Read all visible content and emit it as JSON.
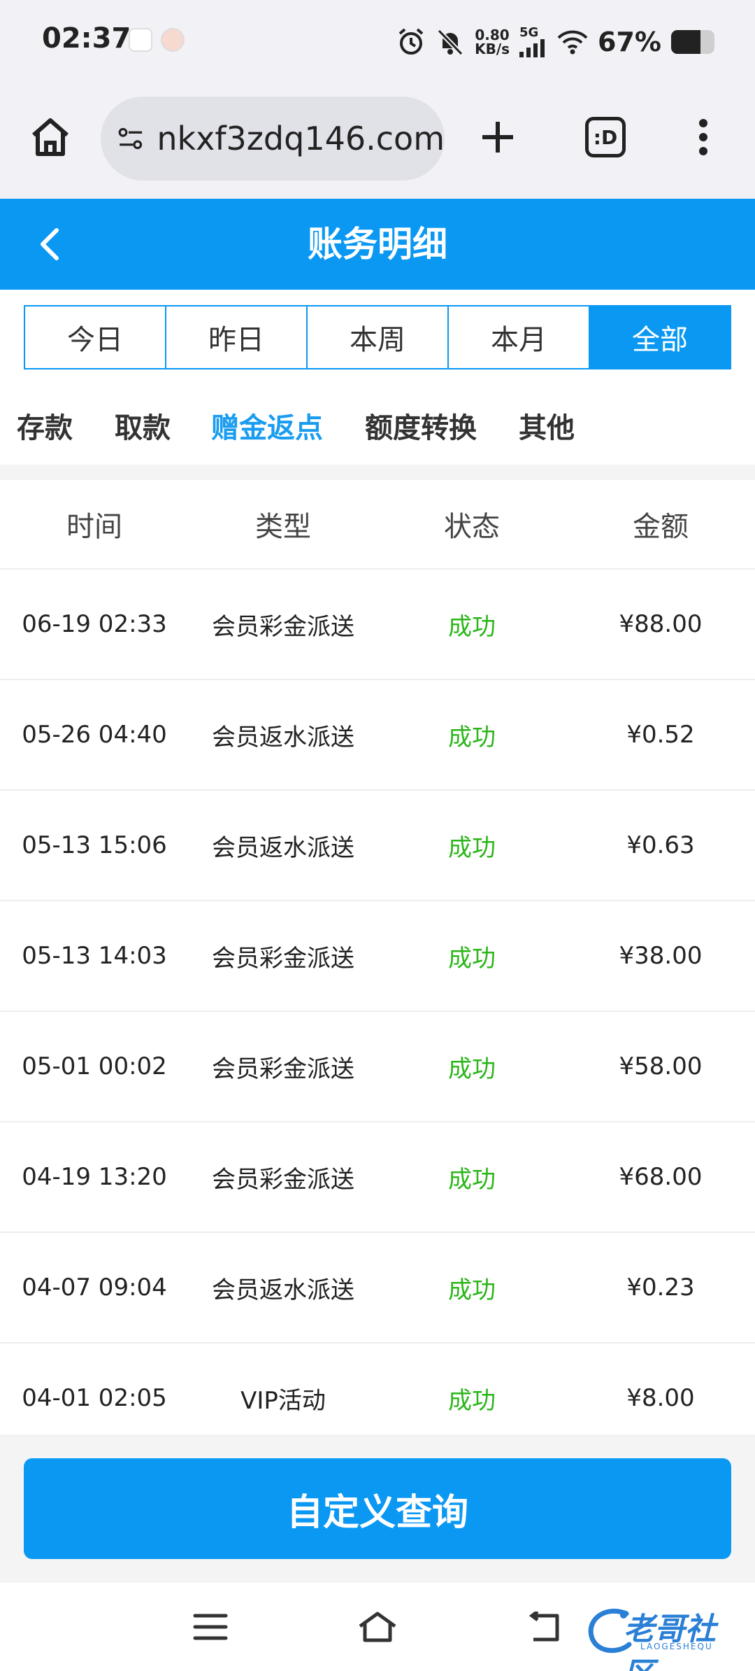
{
  "status_bar": {
    "time": "02:37",
    "network_speed_value": "0.80",
    "network_speed_unit": "KB/s",
    "network_type": "5G",
    "battery_text": "67%",
    "battery_level": 0.67
  },
  "browser": {
    "url": "nkxf3zdq146.com",
    "tabs_label": ":D"
  },
  "header": {
    "title": "账务明细"
  },
  "period_tabs": [
    {
      "label": "今日",
      "active": false
    },
    {
      "label": "昨日",
      "active": false
    },
    {
      "label": "本周",
      "active": false
    },
    {
      "label": "本月",
      "active": false
    },
    {
      "label": "全部",
      "active": true
    }
  ],
  "category_tabs": [
    {
      "label": "存款",
      "active": false
    },
    {
      "label": "取款",
      "active": false
    },
    {
      "label": "赠金返点",
      "active": true
    },
    {
      "label": "额度转换",
      "active": false
    },
    {
      "label": "其他",
      "active": false
    }
  ],
  "table": {
    "headers": [
      "时间",
      "类型",
      "状态",
      "金额"
    ],
    "rows": [
      {
        "time": "06-19 02:33",
        "type": "会员彩金派送",
        "status": "成功",
        "amount": "¥88.00"
      },
      {
        "time": "05-26 04:40",
        "type": "会员返水派送",
        "status": "成功",
        "amount": "¥0.52"
      },
      {
        "time": "05-13 15:06",
        "type": "会员返水派送",
        "status": "成功",
        "amount": "¥0.63"
      },
      {
        "time": "05-13 14:03",
        "type": "会员彩金派送",
        "status": "成功",
        "amount": "¥38.00"
      },
      {
        "time": "05-01 00:02",
        "type": "会员彩金派送",
        "status": "成功",
        "amount": "¥58.00"
      },
      {
        "time": "04-19 13:20",
        "type": "会员彩金派送",
        "status": "成功",
        "amount": "¥68.00"
      },
      {
        "time": "04-07 09:04",
        "type": "会员返水派送",
        "status": "成功",
        "amount": "¥0.23"
      },
      {
        "time": "04-01 02:05",
        "type": "VIP活动",
        "status": "成功",
        "amount": "¥8.00"
      }
    ]
  },
  "query_button": {
    "label": "自定义查询"
  },
  "watermark": {
    "text": "老哥社区",
    "sub": "LAOGESHEQU"
  },
  "colors": {
    "accent": "#0a98f3",
    "success": "#2bb619",
    "active_category": "#1a9cf0"
  }
}
